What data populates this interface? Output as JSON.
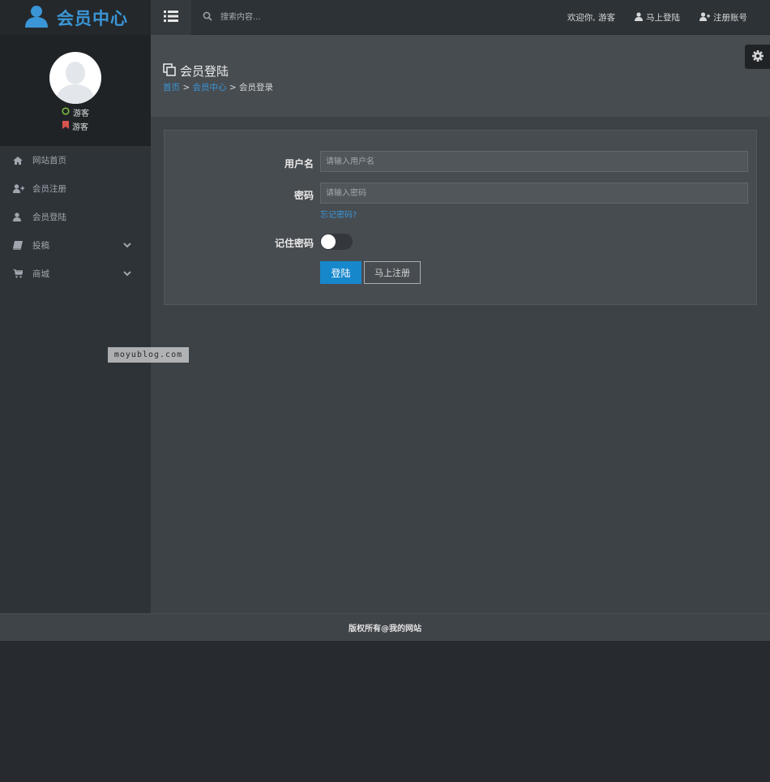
{
  "header": {
    "logo_text": "会员中心",
    "search_placeholder": "搜索内容...",
    "welcome": "欢迎你, 游客",
    "login_link": "马上登陆",
    "register_link": "注册账号"
  },
  "profile": {
    "status": "游客",
    "role": "游客"
  },
  "sidebar": {
    "items": [
      {
        "label": "网站首页",
        "icon": "home-icon"
      },
      {
        "label": "会员注册",
        "icon": "user-plus-icon"
      },
      {
        "label": "会员登陆",
        "icon": "user-icon"
      },
      {
        "label": "投稿",
        "icon": "book-icon",
        "has_submenu": true
      },
      {
        "label": "商城",
        "icon": "cart-icon",
        "has_submenu": true
      }
    ]
  },
  "page": {
    "title": "会员登陆",
    "breadcrumb": {
      "home": "首页",
      "sep1": ">",
      "member_center": "会员中心",
      "sep2": ">",
      "current": "会员登录"
    }
  },
  "login_form": {
    "username_label": "用户名",
    "username_placeholder": "请输入用户名",
    "password_label": "密码",
    "password_placeholder": "请输入密码",
    "forgot_link": "忘记密码?",
    "remember_label": "记住密码",
    "remember_checked": false,
    "login_button": "登陆",
    "register_button": "马上注册"
  },
  "watermark": "moyublog.com",
  "footer": {
    "copyright": "版权所有@我的网站"
  },
  "colors": {
    "accent": "#3a96d6",
    "primary_button": "#1787cc",
    "online_status": "#7fc241",
    "bookmark": "#d9534f"
  }
}
